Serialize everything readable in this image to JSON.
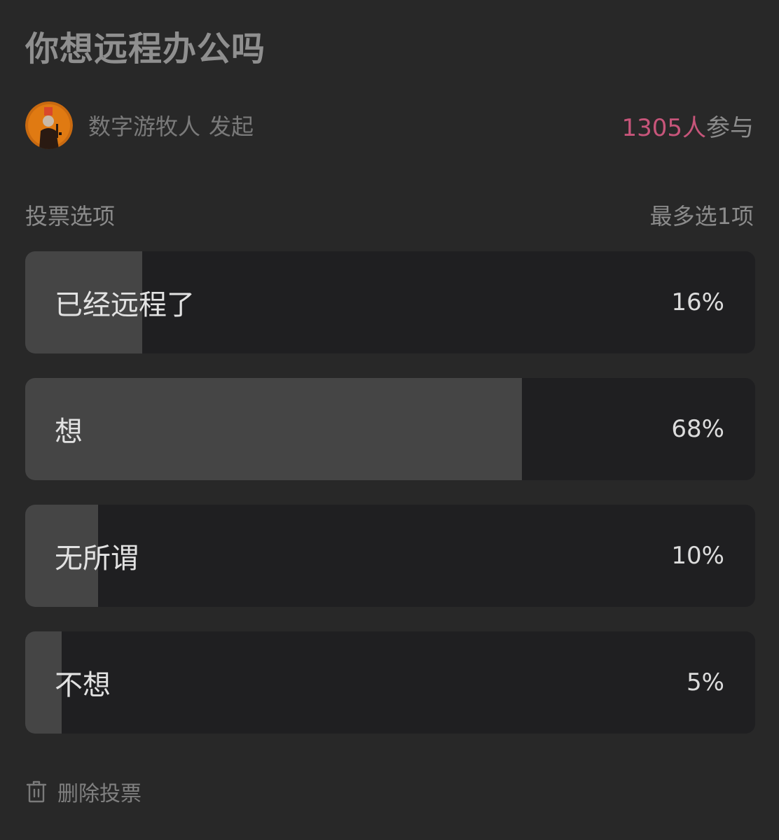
{
  "poll": {
    "title": "你想远程办公吗",
    "author": {
      "name": "数字游牧人",
      "action": "发起"
    },
    "participants": {
      "count": "1305人",
      "suffix": "参与"
    },
    "options_header": {
      "label": "投票选项",
      "limit": "最多选1项"
    },
    "options": [
      {
        "label": "已经远程了",
        "percent_text": "16%",
        "percent": 16
      },
      {
        "label": "想",
        "percent_text": "68%",
        "percent": 68
      },
      {
        "label": "无所谓",
        "percent_text": "10%",
        "percent": 10
      },
      {
        "label": "不想",
        "percent_text": "5%",
        "percent": 5
      }
    ],
    "delete_label": "删除投票"
  },
  "icons": {
    "avatar": "avatar",
    "delete": "trash-icon"
  },
  "colors": {
    "background": "#282828",
    "option_track": "#1f1f21",
    "option_fill": "#454545",
    "accent": "#c7557a"
  }
}
